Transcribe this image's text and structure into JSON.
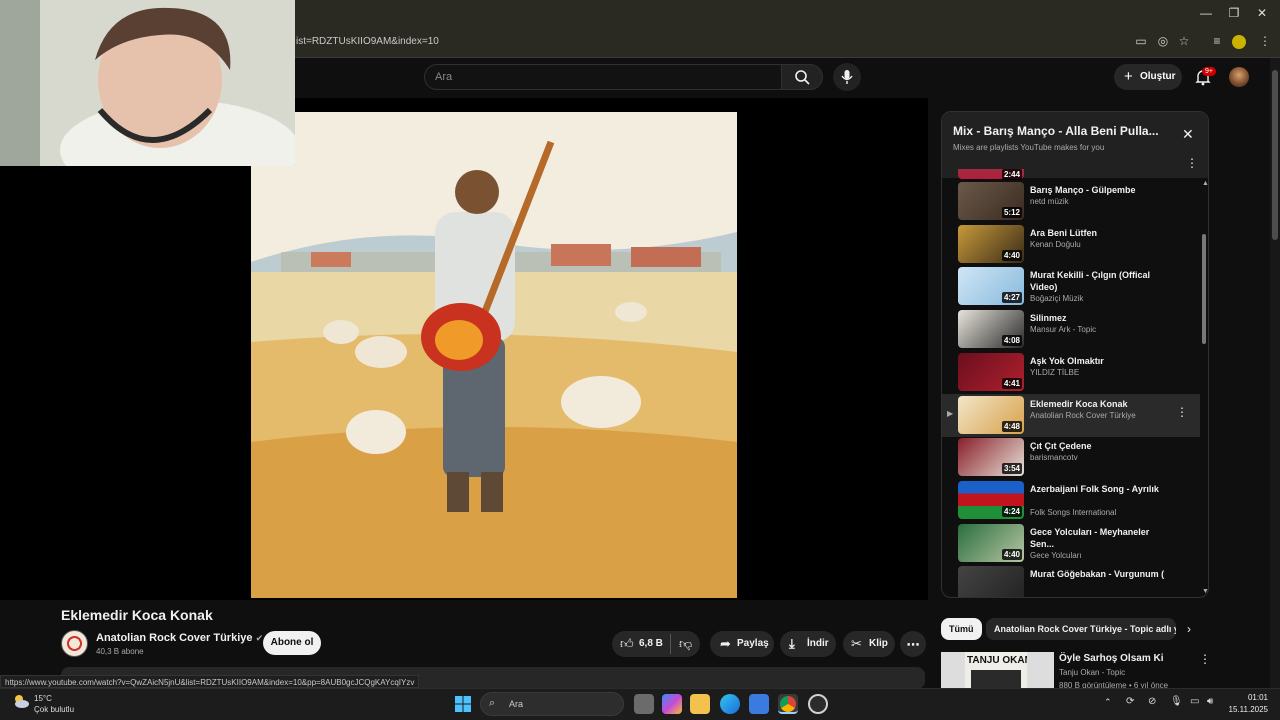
{
  "browser": {
    "url": "ist=RDZTUsKIIO9AM&index=10",
    "status_url": "https://www.youtube.com/watch?v=QwZAicN5jnU&list=RDZTUsKIIO9AM&index=10&pp=8AUB0gcJCQgKAYcqIYzv"
  },
  "header": {
    "search_placeholder": "Ara",
    "create_label": "Oluştur",
    "notification_count": "9+"
  },
  "video": {
    "title": "Eklemedir Koca Konak",
    "channel": "Anatolian Rock Cover Türkiye",
    "subscribers": "40,3 B abone",
    "subscribe_label": "Abone ol",
    "likes": "6,8 B",
    "share_label": "Paylaş",
    "download_label": "İndir",
    "clip_label": "Klip"
  },
  "playlist": {
    "title": "Mix - Barış Manço - Alla Beni Pulla...",
    "subtitle": "Mixes are playlists YouTube makes for you",
    "partial_top_duration": "2:44",
    "items": [
      {
        "title": "Barış Manço - Gülpembe",
        "channel": "netd müzik",
        "duration": "5:12",
        "active": false
      },
      {
        "title": "Ara Beni Lütfen",
        "channel": "Kenan Doğulu",
        "duration": "4:40",
        "active": false
      },
      {
        "title": "Murat Kekilli - Çılgın (Offical Video)",
        "channel": "Boğaziçi Müzik",
        "duration": "4:27",
        "active": false
      },
      {
        "title": "Silinmez",
        "channel": "Mansur Ark - Topic",
        "duration": "4:08",
        "active": false
      },
      {
        "title": "Aşk Yok Olmaktır",
        "channel": "YILDIZ TİLBE",
        "duration": "4:41",
        "active": false
      },
      {
        "title": "Eklemedir Koca Konak",
        "channel": "Anatolian Rock Cover Türkiye",
        "duration": "4:48",
        "active": true
      },
      {
        "title": "Çıt Çıt Çedene",
        "channel": "barismancotv",
        "duration": "3:54",
        "active": false
      },
      {
        "title": "Azerbaijani Folk Song - Ayrılık",
        "channel": "Folk Songs International",
        "duration": "4:24",
        "active": false
      },
      {
        "title": "Gece Yolcuları - Meyhaneler Sen...",
        "channel": "Gece Yolcuları",
        "duration": "4:40",
        "active": false
      },
      {
        "title": "Murat Göğebakan - Vurgunum (",
        "channel": "",
        "duration": "",
        "active": false
      }
    ]
  },
  "chips": {
    "all": "Tümü",
    "second": "Anatolian Rock Cover Türkiye - Topic adlı y"
  },
  "recommendation": {
    "title": "Öyle Sarhoş Olsam Ki",
    "channel": "Tanju Okan - Topic",
    "stats": "880 B görüntüleme • 6 yıl önce",
    "thumb_text": "TANJU OKAN"
  },
  "taskbar": {
    "temperature": "15°C",
    "weather": "Çok bulutlu",
    "search_label": "Ara",
    "time": "01:01",
    "date": "15.11.2025"
  },
  "colors": {
    "background": "#0f0f0f",
    "chrome": "#2b2a22",
    "active_row": "#2a2a2a",
    "accent_red": "#cc0000"
  }
}
